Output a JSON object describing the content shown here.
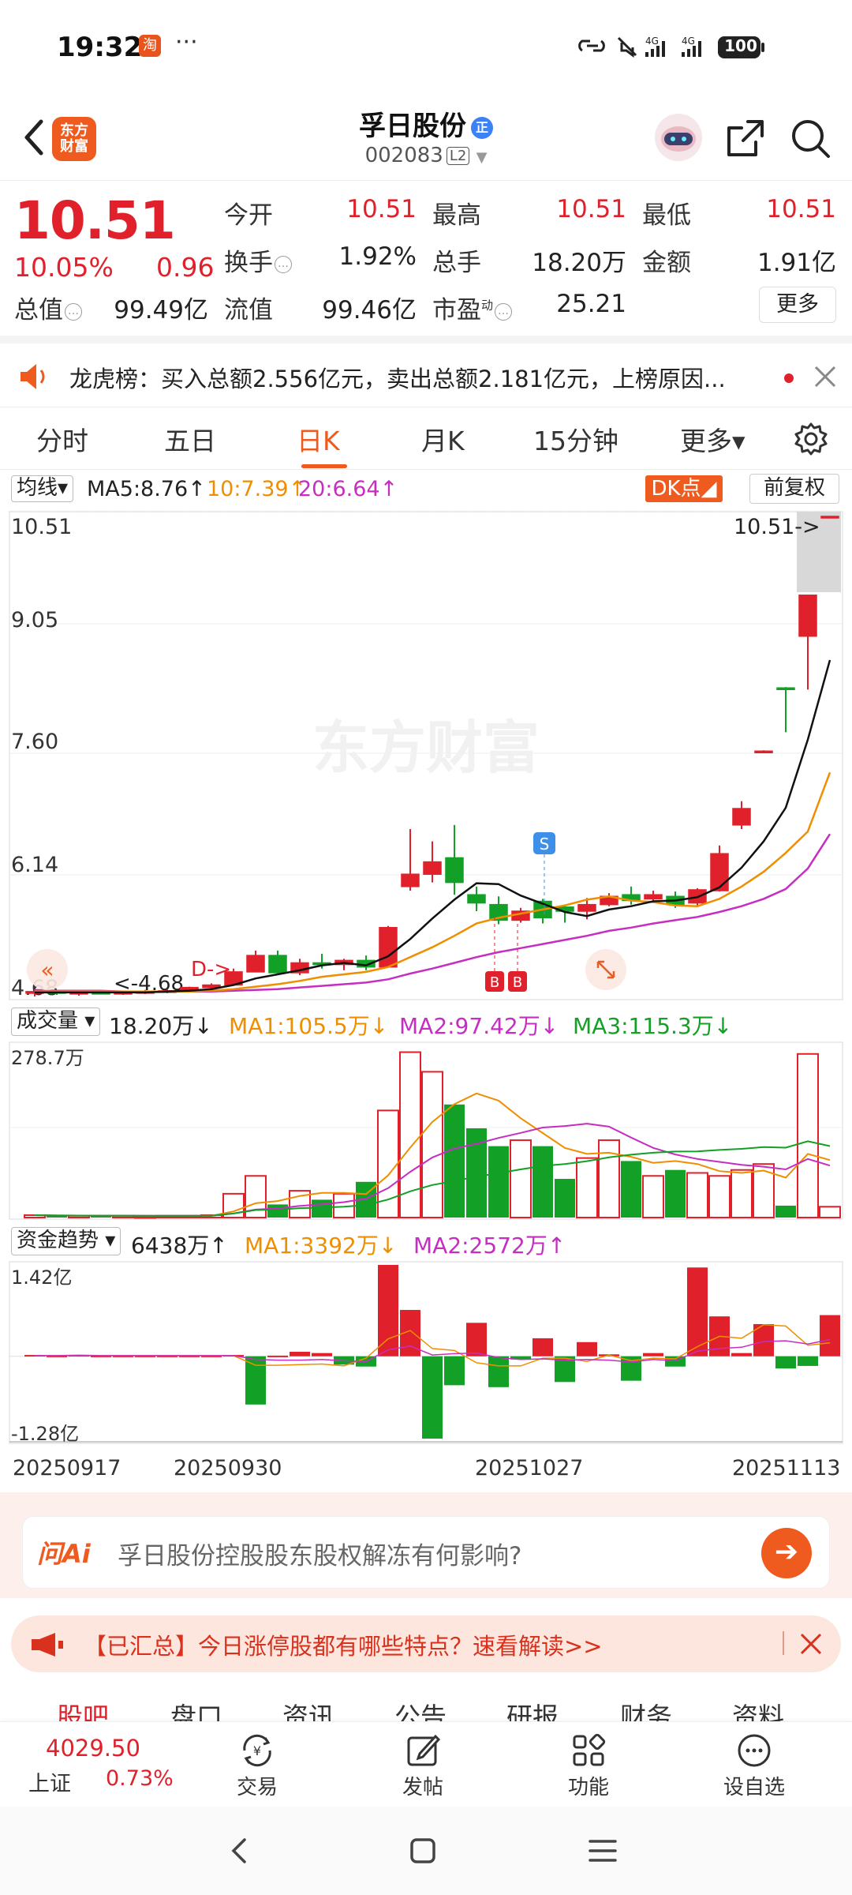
{
  "status_bar": {
    "time": "19:32",
    "overflow_dots": "···",
    "battery": "100"
  },
  "header": {
    "logo_text": "东方\n财富",
    "stock_name": "孚日股份",
    "badge": "正",
    "stock_code": "002083",
    "level_tag": "L2"
  },
  "quote": {
    "price": "10.51",
    "change_pct": "10.05%",
    "change": "0.96",
    "fields": [
      {
        "label": "今开",
        "value": "10.51"
      },
      {
        "label": "最高",
        "value": "10.51"
      },
      {
        "label": "最低",
        "value": "10.51"
      },
      {
        "label": "换手",
        "value": "1.92%"
      },
      {
        "label": "总手",
        "value": "18.20万"
      },
      {
        "label": "金额",
        "value": "1.91亿"
      },
      {
        "label": "总值",
        "value": "99.49亿"
      },
      {
        "label": "流值",
        "value": "99.46亿"
      },
      {
        "label": "市盈",
        "value": "25.21"
      }
    ],
    "pe_superscript": "动",
    "more_label": "更多"
  },
  "lhb": {
    "text": "龙虎榜：买入总额2.556亿元，卖出总额2.181亿元，上榜原因..."
  },
  "tabs": {
    "items": [
      "分时",
      "五日",
      "日K",
      "月K",
      "15分钟",
      "更多▾"
    ],
    "active": "日K"
  },
  "ma_bar": {
    "select": "均线",
    "ma5": "MA5:8.76↑",
    "ma10": "10:7.39↑",
    "ma20": "20:6.64↑",
    "dk_label": "DK点",
    "fq_label": "前复权"
  },
  "kline": {
    "y_labels": [
      "10.51",
      "9.05",
      "7.60",
      "6.14",
      "4.68"
    ],
    "last_price_tag": "10.51->",
    "low_tag": "<-4.68",
    "d_marker": "D->",
    "s_marker": "S",
    "b_marker": "B",
    "watermark": "东方财富"
  },
  "volume": {
    "select": "成交量",
    "current": "18.20万↓",
    "ma1": "MA1:105.5万↓",
    "ma2": "MA2:97.42万↓",
    "ma3": "MA3:115.3万↓",
    "y_top": "278.7万"
  },
  "fund": {
    "select": "资金趋势",
    "current": "6438万↑",
    "ma1": "MA1:3392万↓",
    "ma2": "MA2:2572万↑",
    "y_top": "1.42亿",
    "y_bottom": "-1.28亿"
  },
  "dates": [
    "20250917",
    "20250930",
    "20251027",
    "20251113"
  ],
  "ai_bar": {
    "logo": "问Ai",
    "question": "孚日股份控股股东股权解冻有何影响?"
  },
  "notice": {
    "text": "【已汇总】今日涨停股都有哪些特点？速看解读>>"
  },
  "sub_tabs": [
    "股吧",
    "盘口",
    "资讯",
    "公告",
    "研报",
    "财务",
    "资料"
  ],
  "bottom_bar": {
    "index_value": "4029.50",
    "index_name": "上证",
    "index_pct": "0.73%",
    "items": [
      "交易",
      "发帖",
      "功能",
      "设自选"
    ]
  },
  "colors": {
    "up": "#e0212b",
    "down": "#13a026",
    "accent": "#ef5b1e",
    "ma10": "#ef8f00",
    "ma20": "#c62ec2"
  },
  "chart_data": {
    "type": "candlestick",
    "candles": [
      {
        "o": 4.7,
        "h": 4.75,
        "l": 4.66,
        "c": 4.72
      },
      {
        "o": 4.72,
        "h": 4.74,
        "l": 4.68,
        "c": 4.7
      },
      {
        "o": 4.7,
        "h": 4.72,
        "l": 4.67,
        "c": 4.71
      },
      {
        "o": 4.71,
        "h": 4.73,
        "l": 4.69,
        "c": 4.7
      },
      {
        "o": 4.7,
        "h": 4.72,
        "l": 4.68,
        "c": 4.71
      },
      {
        "o": 4.71,
        "h": 4.74,
        "l": 4.69,
        "c": 4.72
      },
      {
        "o": 4.72,
        "h": 4.75,
        "l": 4.7,
        "c": 4.73
      },
      {
        "o": 4.73,
        "h": 4.78,
        "l": 4.72,
        "c": 4.77
      },
      {
        "o": 4.77,
        "h": 4.82,
        "l": 4.76,
        "c": 4.8
      },
      {
        "o": 4.8,
        "h": 5.0,
        "l": 4.8,
        "c": 4.96
      },
      {
        "o": 4.96,
        "h": 5.22,
        "l": 4.96,
        "c": 5.16
      },
      {
        "o": 5.16,
        "h": 5.22,
        "l": 4.92,
        "c": 4.95
      },
      {
        "o": 4.95,
        "h": 5.12,
        "l": 4.92,
        "c": 5.07
      },
      {
        "o": 5.07,
        "h": 5.18,
        "l": 5.0,
        "c": 5.05
      },
      {
        "o": 5.05,
        "h": 5.12,
        "l": 4.98,
        "c": 5.1
      },
      {
        "o": 5.1,
        "h": 5.16,
        "l": 4.98,
        "c": 5.02
      },
      {
        "o": 5.02,
        "h": 5.52,
        "l": 5.02,
        "c": 5.5
      },
      {
        "o": 6.0,
        "h": 6.7,
        "l": 5.95,
        "c": 6.15
      },
      {
        "o": 6.15,
        "h": 6.55,
        "l": 6.05,
        "c": 6.3
      },
      {
        "o": 6.35,
        "h": 6.75,
        "l": 5.9,
        "c": 6.05
      },
      {
        "o": 5.9,
        "h": 6.0,
        "l": 5.7,
        "c": 5.8
      },
      {
        "o": 5.78,
        "h": 5.88,
        "l": 5.54,
        "c": 5.59
      },
      {
        "o": 5.59,
        "h": 5.74,
        "l": 5.56,
        "c": 5.7
      },
      {
        "o": 5.82,
        "h": 5.85,
        "l": 5.55,
        "c": 5.62
      },
      {
        "o": 5.75,
        "h": 5.78,
        "l": 5.56,
        "c": 5.7
      },
      {
        "o": 5.7,
        "h": 5.86,
        "l": 5.6,
        "c": 5.78
      },
      {
        "o": 5.78,
        "h": 5.92,
        "l": 5.76,
        "c": 5.88
      },
      {
        "o": 5.9,
        "h": 6.0,
        "l": 5.78,
        "c": 5.83
      },
      {
        "o": 5.85,
        "h": 5.95,
        "l": 5.8,
        "c": 5.9
      },
      {
        "o": 5.88,
        "h": 5.94,
        "l": 5.74,
        "c": 5.78
      },
      {
        "o": 5.8,
        "h": 5.98,
        "l": 5.76,
        "c": 5.96
      },
      {
        "o": 5.95,
        "h": 6.5,
        "l": 5.94,
        "c": 6.4
      },
      {
        "o": 6.75,
        "h": 7.04,
        "l": 6.7,
        "c": 6.95
      },
      {
        "o": 7.65,
        "h": 7.66,
        "l": 7.64,
        "c": 7.65
      },
      {
        "o": 8.42,
        "h": 8.43,
        "l": 7.88,
        "c": 8.41
      },
      {
        "o": 9.05,
        "h": 9.5,
        "l": 8.4,
        "c": 9.55
      },
      {
        "o": 10.51,
        "h": 10.51,
        "l": 10.51,
        "c": 10.51
      }
    ],
    "ma5": [
      4.71,
      4.71,
      4.71,
      4.71,
      4.71,
      4.71,
      4.72,
      4.73,
      4.75,
      4.8,
      4.88,
      4.93,
      4.98,
      5.04,
      5.07,
      5.04,
      5.15,
      5.36,
      5.61,
      5.84,
      6.04,
      6.03,
      5.89,
      5.79,
      5.69,
      5.64,
      5.72,
      5.76,
      5.82,
      5.83,
      5.87,
      5.99,
      6.23,
      6.55,
      6.96,
      7.79,
      8.76
    ],
    "ma10": [
      4.72,
      4.72,
      4.72,
      4.72,
      4.72,
      4.72,
      4.72,
      4.72,
      4.73,
      4.75,
      4.78,
      4.81,
      4.85,
      4.9,
      4.93,
      4.96,
      5.02,
      5.14,
      5.26,
      5.4,
      5.55,
      5.62,
      5.67,
      5.72,
      5.77,
      5.84,
      5.88,
      5.83,
      5.81,
      5.77,
      5.76,
      5.85,
      6.0,
      6.18,
      6.41,
      6.67,
      7.39
    ],
    "ma20": [
      4.74,
      4.73,
      4.73,
      4.73,
      4.72,
      4.72,
      4.72,
      4.72,
      4.72,
      4.73,
      4.74,
      4.75,
      4.77,
      4.79,
      4.81,
      4.83,
      4.87,
      4.94,
      5.0,
      5.07,
      5.14,
      5.2,
      5.25,
      5.3,
      5.35,
      5.4,
      5.46,
      5.5,
      5.55,
      5.59,
      5.63,
      5.69,
      5.76,
      5.85,
      5.97,
      6.22,
      6.64
    ],
    "volume_wan": [
      4,
      3,
      3,
      3,
      3,
      2,
      3,
      3,
      4,
      40,
      70,
      22,
      45,
      30,
      40,
      60,
      180,
      278,
      245,
      190,
      150,
      120,
      130,
      120,
      65,
      100,
      130,
      95,
      70,
      80,
      75,
      70,
      80,
      90,
      20,
      275,
      18.2
    ],
    "fund_yi": [
      0.02,
      0.01,
      0.02,
      0.01,
      0.01,
      0.01,
      0.01,
      0.01,
      0.01,
      0.02,
      -0.75,
      0.01,
      0.07,
      0.05,
      -0.13,
      -0.16,
      1.42,
      0.72,
      -1.28,
      -0.45,
      0.52,
      -0.48,
      -0.05,
      0.28,
      -0.4,
      0.22,
      0.03,
      -0.38,
      0.05,
      -0.16,
      1.38,
      0.62,
      0.05,
      0.5,
      -0.19,
      -0.15,
      0.64
    ],
    "fund_ma1": [
      0.01,
      0.01,
      0.02,
      0.01,
      0.01,
      0.01,
      0.01,
      0.01,
      0.01,
      0.01,
      -0.14,
      -0.14,
      -0.13,
      -0.12,
      -0.15,
      -0.03,
      0.27,
      0.4,
      0.12,
      0.09,
      -0.1,
      -0.15,
      -0.15,
      -0.03,
      -0.03,
      -0.08,
      0.02,
      -0.07,
      -0.03,
      -0.04,
      0.15,
      0.31,
      0.28,
      0.49,
      0.47,
      0.17,
      0.21
    ],
    "fund_ma2": [
      0.01,
      0.01,
      0.01,
      0.01,
      0.01,
      0.01,
      0.01,
      0.01,
      0.01,
      0.01,
      -0.05,
      -0.06,
      -0.06,
      -0.05,
      -0.07,
      -0.08,
      0.1,
      0.16,
      0.02,
      0.04,
      0.05,
      -0.02,
      -0.05,
      -0.04,
      -0.06,
      -0.05,
      -0.06,
      -0.09,
      -0.05,
      -0.07,
      0.08,
      0.12,
      0.14,
      0.23,
      0.24,
      0.19,
      0.26
    ],
    "price_range": [
      4.68,
      10.51
    ],
    "volume_range_wan": [
      0,
      278.7
    ],
    "fund_range_yi": [
      -1.28,
      1.42
    ],
    "x_dates": [
      "20250917",
      "20250930",
      "20251027",
      "20251113"
    ]
  }
}
